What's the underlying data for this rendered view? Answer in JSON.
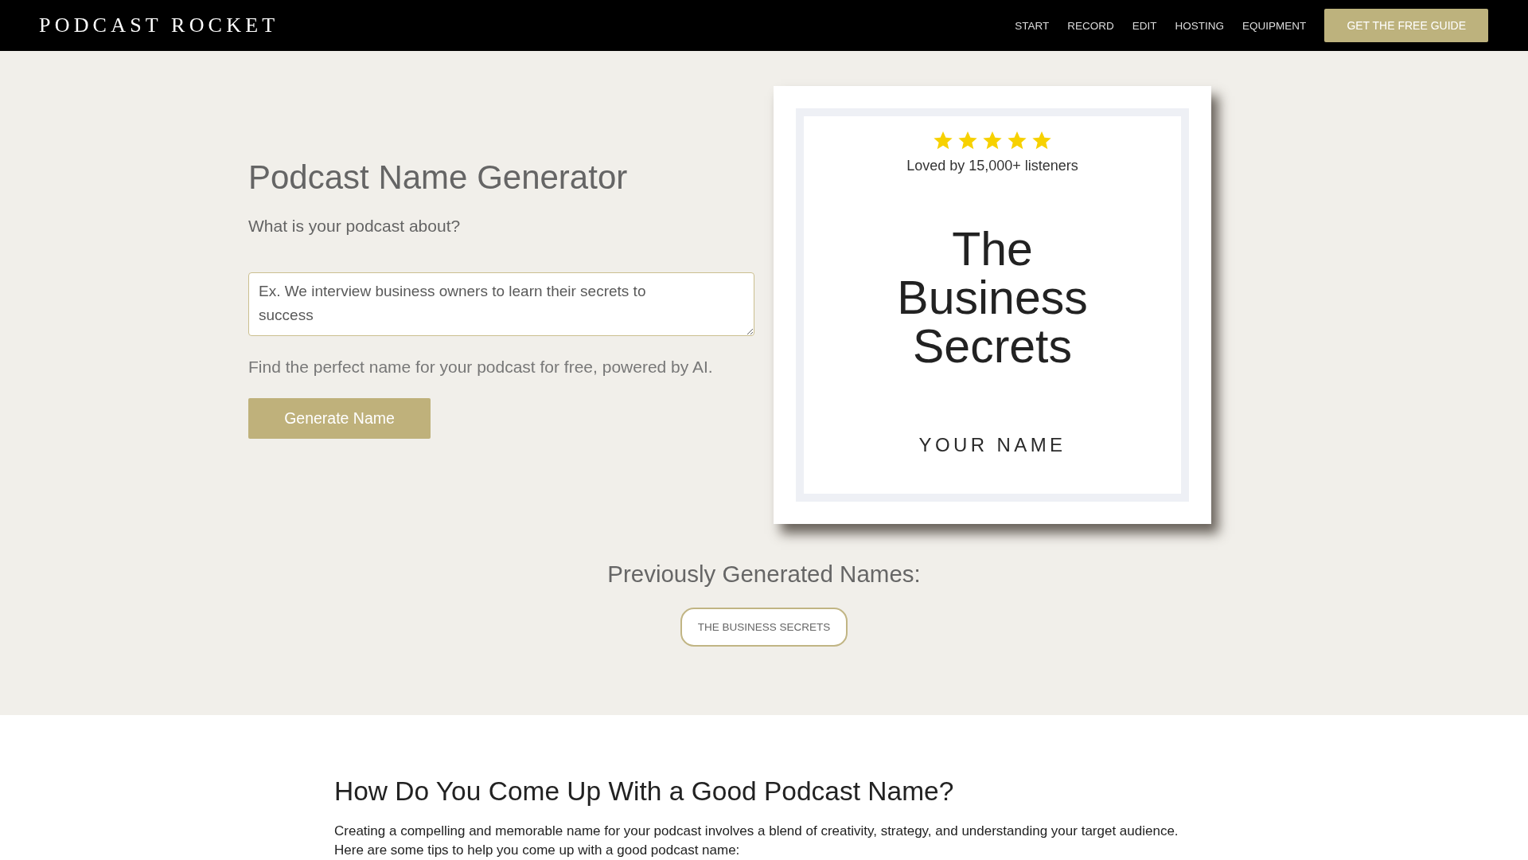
{
  "header": {
    "logo": "PODCAST ROCKET",
    "nav": [
      {
        "label": "START"
      },
      {
        "label": "RECORD"
      },
      {
        "label": "EDIT"
      },
      {
        "label": "HOSTING"
      },
      {
        "label": "EQUIPMENT"
      }
    ],
    "cta": "GET THE FREE GUIDE"
  },
  "generator": {
    "title": "Podcast Name Generator",
    "prompt": "What is your podcast about?",
    "input": {
      "placeholder": "Ex. We interview business owners to learn their secrets to success"
    },
    "note": "Find the perfect name for your podcast for free, powered by AI.",
    "button": "Generate Name"
  },
  "cover": {
    "stars": 5,
    "tagline": "Loved by 15,000+ listeners",
    "title": "The Business Secrets",
    "author": "YOUR NAME"
  },
  "history": {
    "title": "Previously Generated Names:",
    "names": [
      "THE BUSINESS SECRETS"
    ]
  },
  "article": {
    "heading": "How Do You Come Up With a Good Podcast Name?",
    "paragraph": "Creating a compelling and memorable name for your podcast involves a blend of creativity, strategy, and understanding your target audience. Here are some tips to help you come up with a good podcast name:"
  }
}
